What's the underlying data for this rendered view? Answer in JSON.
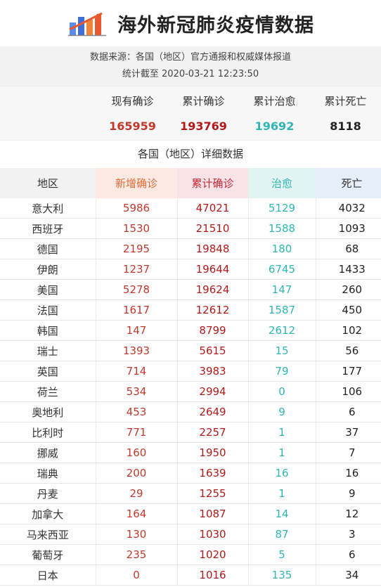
{
  "header": {
    "title": "海外新冠肺炎疫情数据",
    "logo_icon": "bar-chart-trend-icon"
  },
  "meta": {
    "source": "数据来源：各国（地区）官方通报和权威媒体报道",
    "updated": "统计截至 2020-03-21  12:23:50"
  },
  "summary": [
    {
      "label": "现有确诊",
      "value": "165959",
      "color": "#c0392b"
    },
    {
      "label": "累计确诊",
      "value": "193769",
      "color": "#b21a1a"
    },
    {
      "label": "累计治愈",
      "value": "19692",
      "color": "#2fb5b3"
    },
    {
      "label": "累计死亡",
      "value": "8118",
      "color": "#222222"
    }
  ],
  "section_title": "各国（地区）详细数据",
  "table": {
    "headers": {
      "region": "地区",
      "new": "新增确诊",
      "cumulative": "累计确诊",
      "healed": "治愈",
      "deaths": "死亡"
    },
    "rows": [
      {
        "region": "意大利",
        "new": "5986",
        "cumulative": "47021",
        "healed": "5129",
        "deaths": "4032"
      },
      {
        "region": "西班牙",
        "new": "1530",
        "cumulative": "21510",
        "healed": "1588",
        "deaths": "1093"
      },
      {
        "region": "德国",
        "new": "2195",
        "cumulative": "19848",
        "healed": "180",
        "deaths": "68"
      },
      {
        "region": "伊朗",
        "new": "1237",
        "cumulative": "19644",
        "healed": "6745",
        "deaths": "1433"
      },
      {
        "region": "美国",
        "new": "5278",
        "cumulative": "19624",
        "healed": "147",
        "deaths": "260"
      },
      {
        "region": "法国",
        "new": "1617",
        "cumulative": "12612",
        "healed": "1587",
        "deaths": "450"
      },
      {
        "region": "韩国",
        "new": "147",
        "cumulative": "8799",
        "healed": "2612",
        "deaths": "102"
      },
      {
        "region": "瑞士",
        "new": "1393",
        "cumulative": "5615",
        "healed": "15",
        "deaths": "56"
      },
      {
        "region": "英国",
        "new": "714",
        "cumulative": "3983",
        "healed": "79",
        "deaths": "177"
      },
      {
        "region": "荷兰",
        "new": "534",
        "cumulative": "2994",
        "healed": "0",
        "deaths": "106"
      },
      {
        "region": "奥地利",
        "new": "453",
        "cumulative": "2649",
        "healed": "9",
        "deaths": "6"
      },
      {
        "region": "比利时",
        "new": "771",
        "cumulative": "2257",
        "healed": "1",
        "deaths": "37"
      },
      {
        "region": "挪威",
        "new": "160",
        "cumulative": "1950",
        "healed": "1",
        "deaths": "7"
      },
      {
        "region": "瑞典",
        "new": "200",
        "cumulative": "1639",
        "healed": "16",
        "deaths": "16"
      },
      {
        "region": "丹麦",
        "new": "29",
        "cumulative": "1255",
        "healed": "1",
        "deaths": "9"
      },
      {
        "region": "加拿大",
        "new": "164",
        "cumulative": "1087",
        "healed": "14",
        "deaths": "12"
      },
      {
        "region": "马来西亚",
        "new": "130",
        "cumulative": "1030",
        "healed": "87",
        "deaths": "3"
      },
      {
        "region": "葡萄牙",
        "new": "235",
        "cumulative": "1020",
        "healed": "5",
        "deaths": "6"
      },
      {
        "region": "日本",
        "new": "0",
        "cumulative": "1016",
        "healed": "135",
        "deaths": "34"
      }
    ]
  }
}
